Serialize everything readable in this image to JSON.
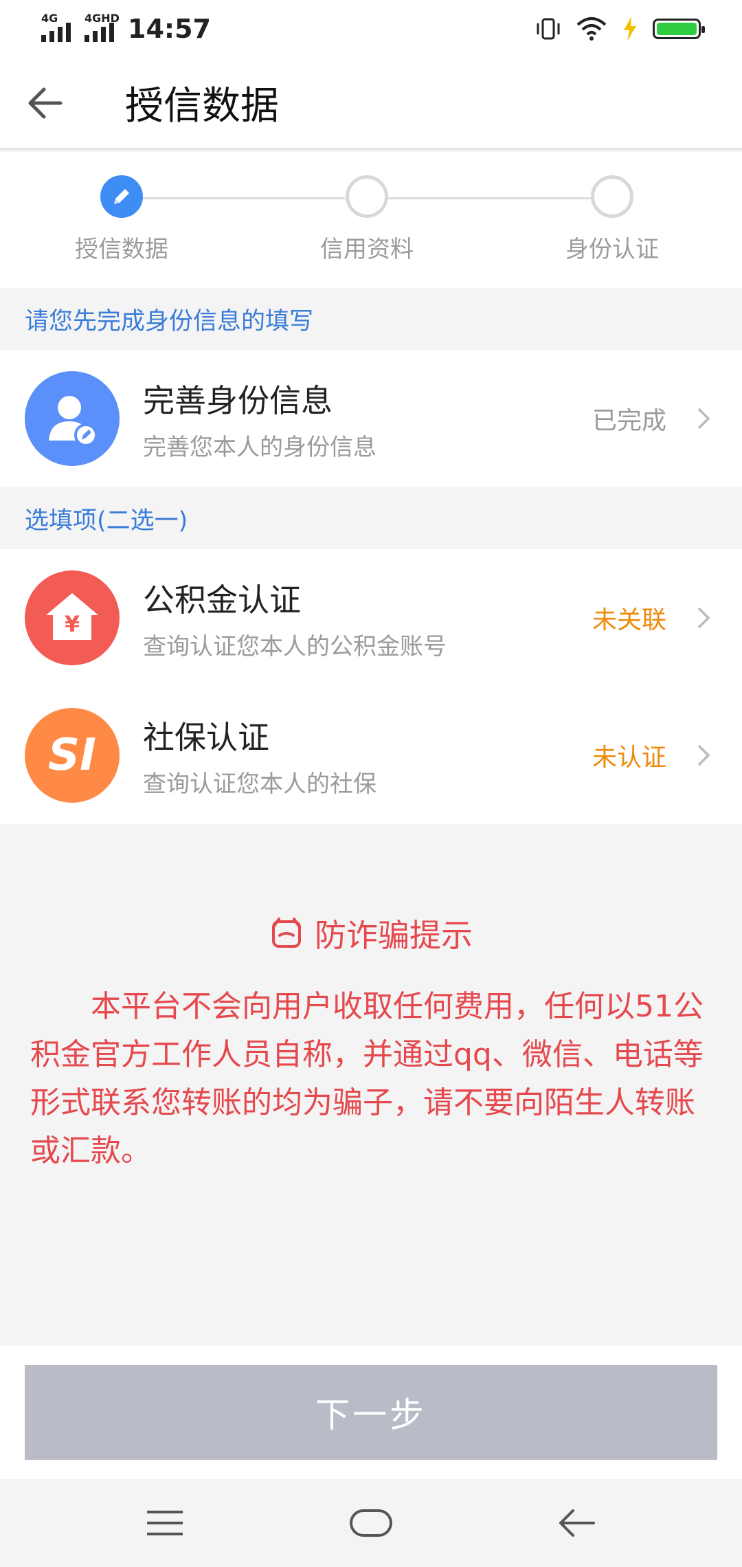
{
  "status_bar": {
    "net1": "4G",
    "net2": "4GHD",
    "time": "14:57"
  },
  "header": {
    "title": "授信数据"
  },
  "stepper": {
    "steps": [
      {
        "label": "授信数据",
        "active": true
      },
      {
        "label": "信用资料",
        "active": false
      },
      {
        "label": "身份认证",
        "active": false
      }
    ]
  },
  "sections": {
    "identity_header": "请您先完成身份信息的填写",
    "optional_header": "选填项(二选一)"
  },
  "items": [
    {
      "title": "完善身份信息",
      "subtitle": "完善您本人的身份信息",
      "status": "已完成",
      "status_color": "#9a9a9f",
      "icon": "person-edit-icon",
      "icon_bg": "#5b8ff9"
    },
    {
      "title": "公积金认证",
      "subtitle": "查询认证您本人的公积金账号",
      "status": "未关联",
      "status_color": "#ee8a0a",
      "icon": "house-yen-icon",
      "icon_bg": "#f25c54"
    },
    {
      "title": "社保认证",
      "subtitle": "查询认证您本人的社保",
      "status": "未认证",
      "status_color": "#ee8a0a",
      "icon": "si-logo-icon",
      "icon_bg": "#ff8a46"
    }
  ],
  "warning": {
    "title": "防诈骗提示",
    "body": "本平台不会向用户收取任何费用，任何以51公积金官方工作人员自称，并通过qq、微信、电话等形式联系您转账的均为骗子，请不要向陌生人转账或汇款。",
    "color": "#e5484d"
  },
  "footer": {
    "next_label": "下一步"
  },
  "colors": {
    "accent": "#3d8df5",
    "section_text": "#3b7cd8"
  }
}
